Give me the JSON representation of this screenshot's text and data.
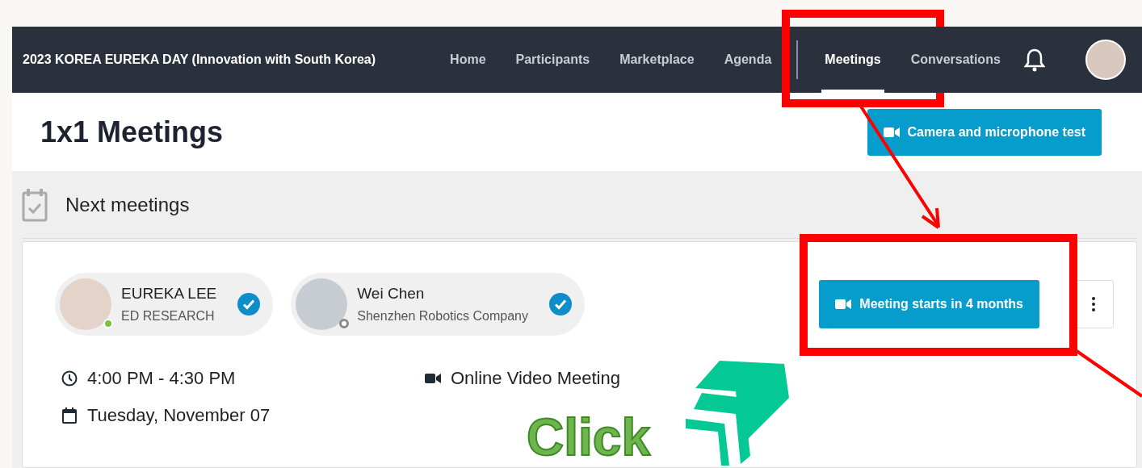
{
  "event_title": "2023 KOREA EUREKA DAY (Innovation with South Korea)",
  "nav": [
    {
      "kind": "link",
      "label": "Home",
      "selected": false
    },
    {
      "kind": "link",
      "label": "Participants",
      "selected": false
    },
    {
      "kind": "link",
      "label": "Marketplace",
      "selected": false
    },
    {
      "kind": "link",
      "label": "Agenda",
      "selected": false
    },
    {
      "kind": "separator"
    },
    {
      "kind": "link",
      "label": "Meetings",
      "selected": true
    },
    {
      "kind": "link",
      "label": "Conversations",
      "selected": false
    }
  ],
  "page_title": "1x1 Meetings",
  "test_button": "Camera and microphone test",
  "section_title": "Next meetings",
  "meeting": {
    "participants": [
      {
        "name": "EUREKA LEE",
        "company": "ED RESEARCH",
        "online": true,
        "confirmed": true
      },
      {
        "name": "Wei Chen",
        "company": "Shenzhen Robotics Company",
        "online": false,
        "confirmed": true
      }
    ],
    "time": "4:00 PM - 4:30 PM",
    "date": "Tuesday, November 07",
    "location": "Online Video Meeting",
    "join_button": "Meeting starts in 4 months"
  },
  "annotation": {
    "callout_text": "Click"
  }
}
